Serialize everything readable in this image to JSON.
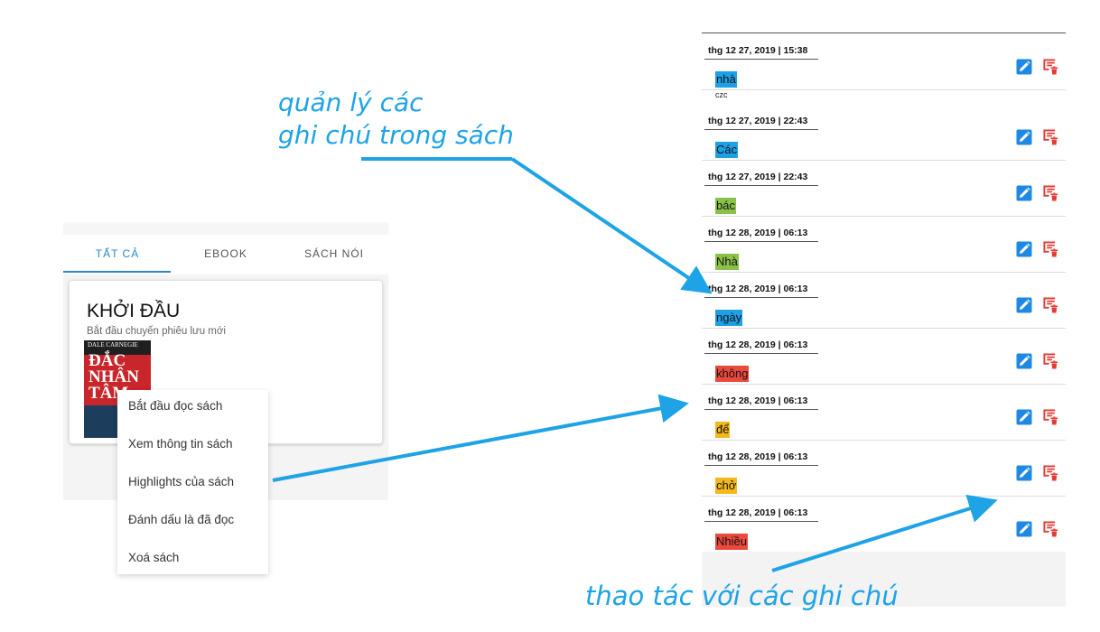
{
  "tabs": [
    {
      "label": "TẤT CẢ",
      "active": true
    },
    {
      "label": "EBOOK",
      "active": false
    },
    {
      "label": "SÁCH NÓI",
      "active": false
    }
  ],
  "card": {
    "title": "KHỞI ĐẦU",
    "subtitle": "Bắt đầu chuyến phiêu lưu mới",
    "cover": {
      "author": "DALE CARNEGIE",
      "title": "ĐẮC NHÂN TÂM"
    }
  },
  "context_menu": [
    "Bắt đầu đọc sách",
    "Xem thông tin sách",
    "Highlights của sách",
    "Đánh dấu là đã đọc",
    "Xoá sách"
  ],
  "notes": [
    {
      "date": "thg 12 27, 2019 | 15:38",
      "word": "nhà",
      "color": "#1ea0e6",
      "comment": "czc"
    },
    {
      "date": "thg 12 27, 2019 | 22:43",
      "word": "Các",
      "color": "#1ea0e6",
      "comment": ""
    },
    {
      "date": "thg 12 27, 2019 | 22:43",
      "word": "bác",
      "color": "#8ac249",
      "comment": ""
    },
    {
      "date": "thg 12 28, 2019 | 06:13",
      "word": "Nhà",
      "color": "#8ac249",
      "comment": ""
    },
    {
      "date": "thg 12 28, 2019 | 06:13",
      "word": "ngày",
      "color": "#1ea0e6",
      "comment": ""
    },
    {
      "date": "thg 12 28, 2019 | 06:13",
      "word": "không",
      "color": "#ea4a3d",
      "comment": ""
    },
    {
      "date": "thg 12 28, 2019 | 06:13",
      "word": "để",
      "color": "#f5b81c",
      "comment": ""
    },
    {
      "date": "thg 12 28, 2019 | 06:13",
      "word": "chở",
      "color": "#f5b81c",
      "comment": ""
    },
    {
      "date": "thg 12 28, 2019 | 06:13",
      "word": "Nhiều",
      "color": "#ea4a3d",
      "comment": ""
    }
  ],
  "icons": {
    "edit": "edit-icon",
    "delete": "delete-icon"
  },
  "colors": {
    "accent": "#2a87c8",
    "annotation": "#1da3e6",
    "edit_icon": "#1e88e5",
    "delete_icon": "#e53935"
  },
  "annotations": {
    "notes_title": [
      "quản lý các",
      "ghi chú trong sách"
    ],
    "actions": "thao tác với các ghi chú"
  }
}
